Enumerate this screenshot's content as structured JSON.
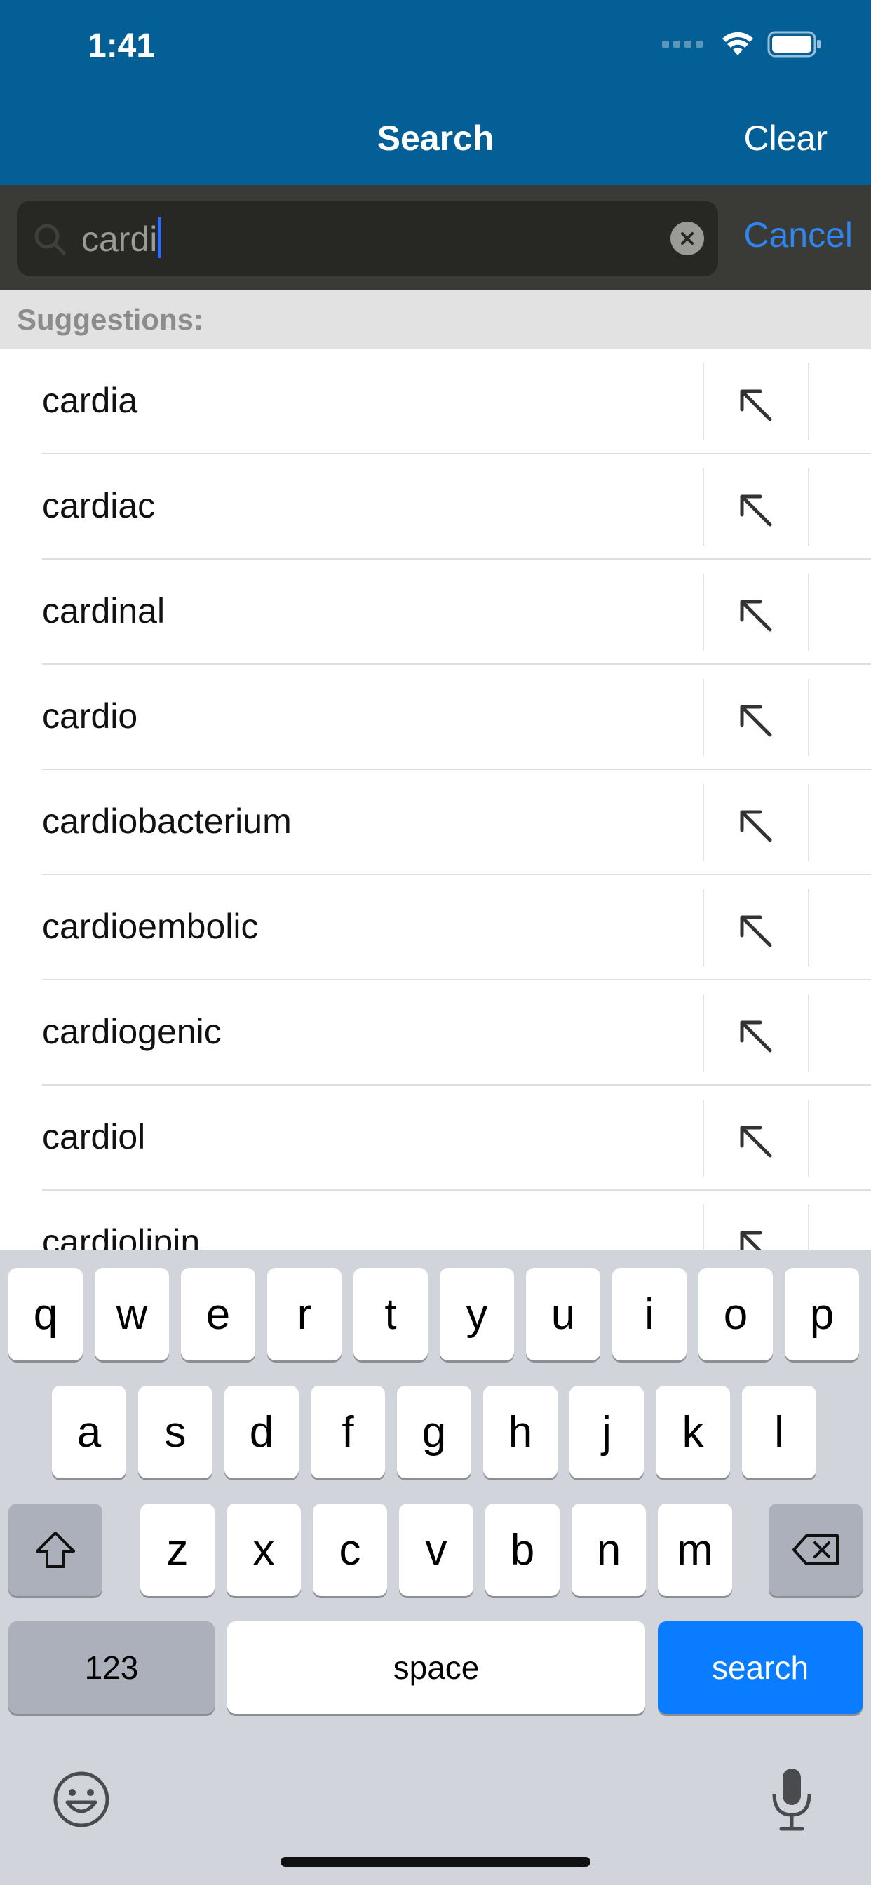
{
  "status_bar": {
    "time": "1:41"
  },
  "nav": {
    "title": "Search",
    "clear_label": "Clear"
  },
  "search": {
    "query": "cardi",
    "cancel_label": "Cancel"
  },
  "suggestions_header": "Suggestions:",
  "suggestions": [
    "cardia",
    "cardiac",
    "cardinal",
    "cardio",
    "cardiobacterium",
    "cardioembolic",
    "cardiogenic",
    "cardiol",
    "cardiolipin"
  ],
  "keyboard": {
    "row1": [
      "q",
      "w",
      "e",
      "r",
      "t",
      "y",
      "u",
      "i",
      "o",
      "p"
    ],
    "row2": [
      "a",
      "s",
      "d",
      "f",
      "g",
      "h",
      "j",
      "k",
      "l"
    ],
    "row3": [
      "z",
      "x",
      "c",
      "v",
      "b",
      "n",
      "m"
    ],
    "numbers_label": "123",
    "space_label": "space",
    "search_label": "search"
  },
  "colors": {
    "header": "#035f96",
    "search_bar": "#3a3a37",
    "accent": "#2f86f0",
    "search_key": "#0a7cff"
  }
}
